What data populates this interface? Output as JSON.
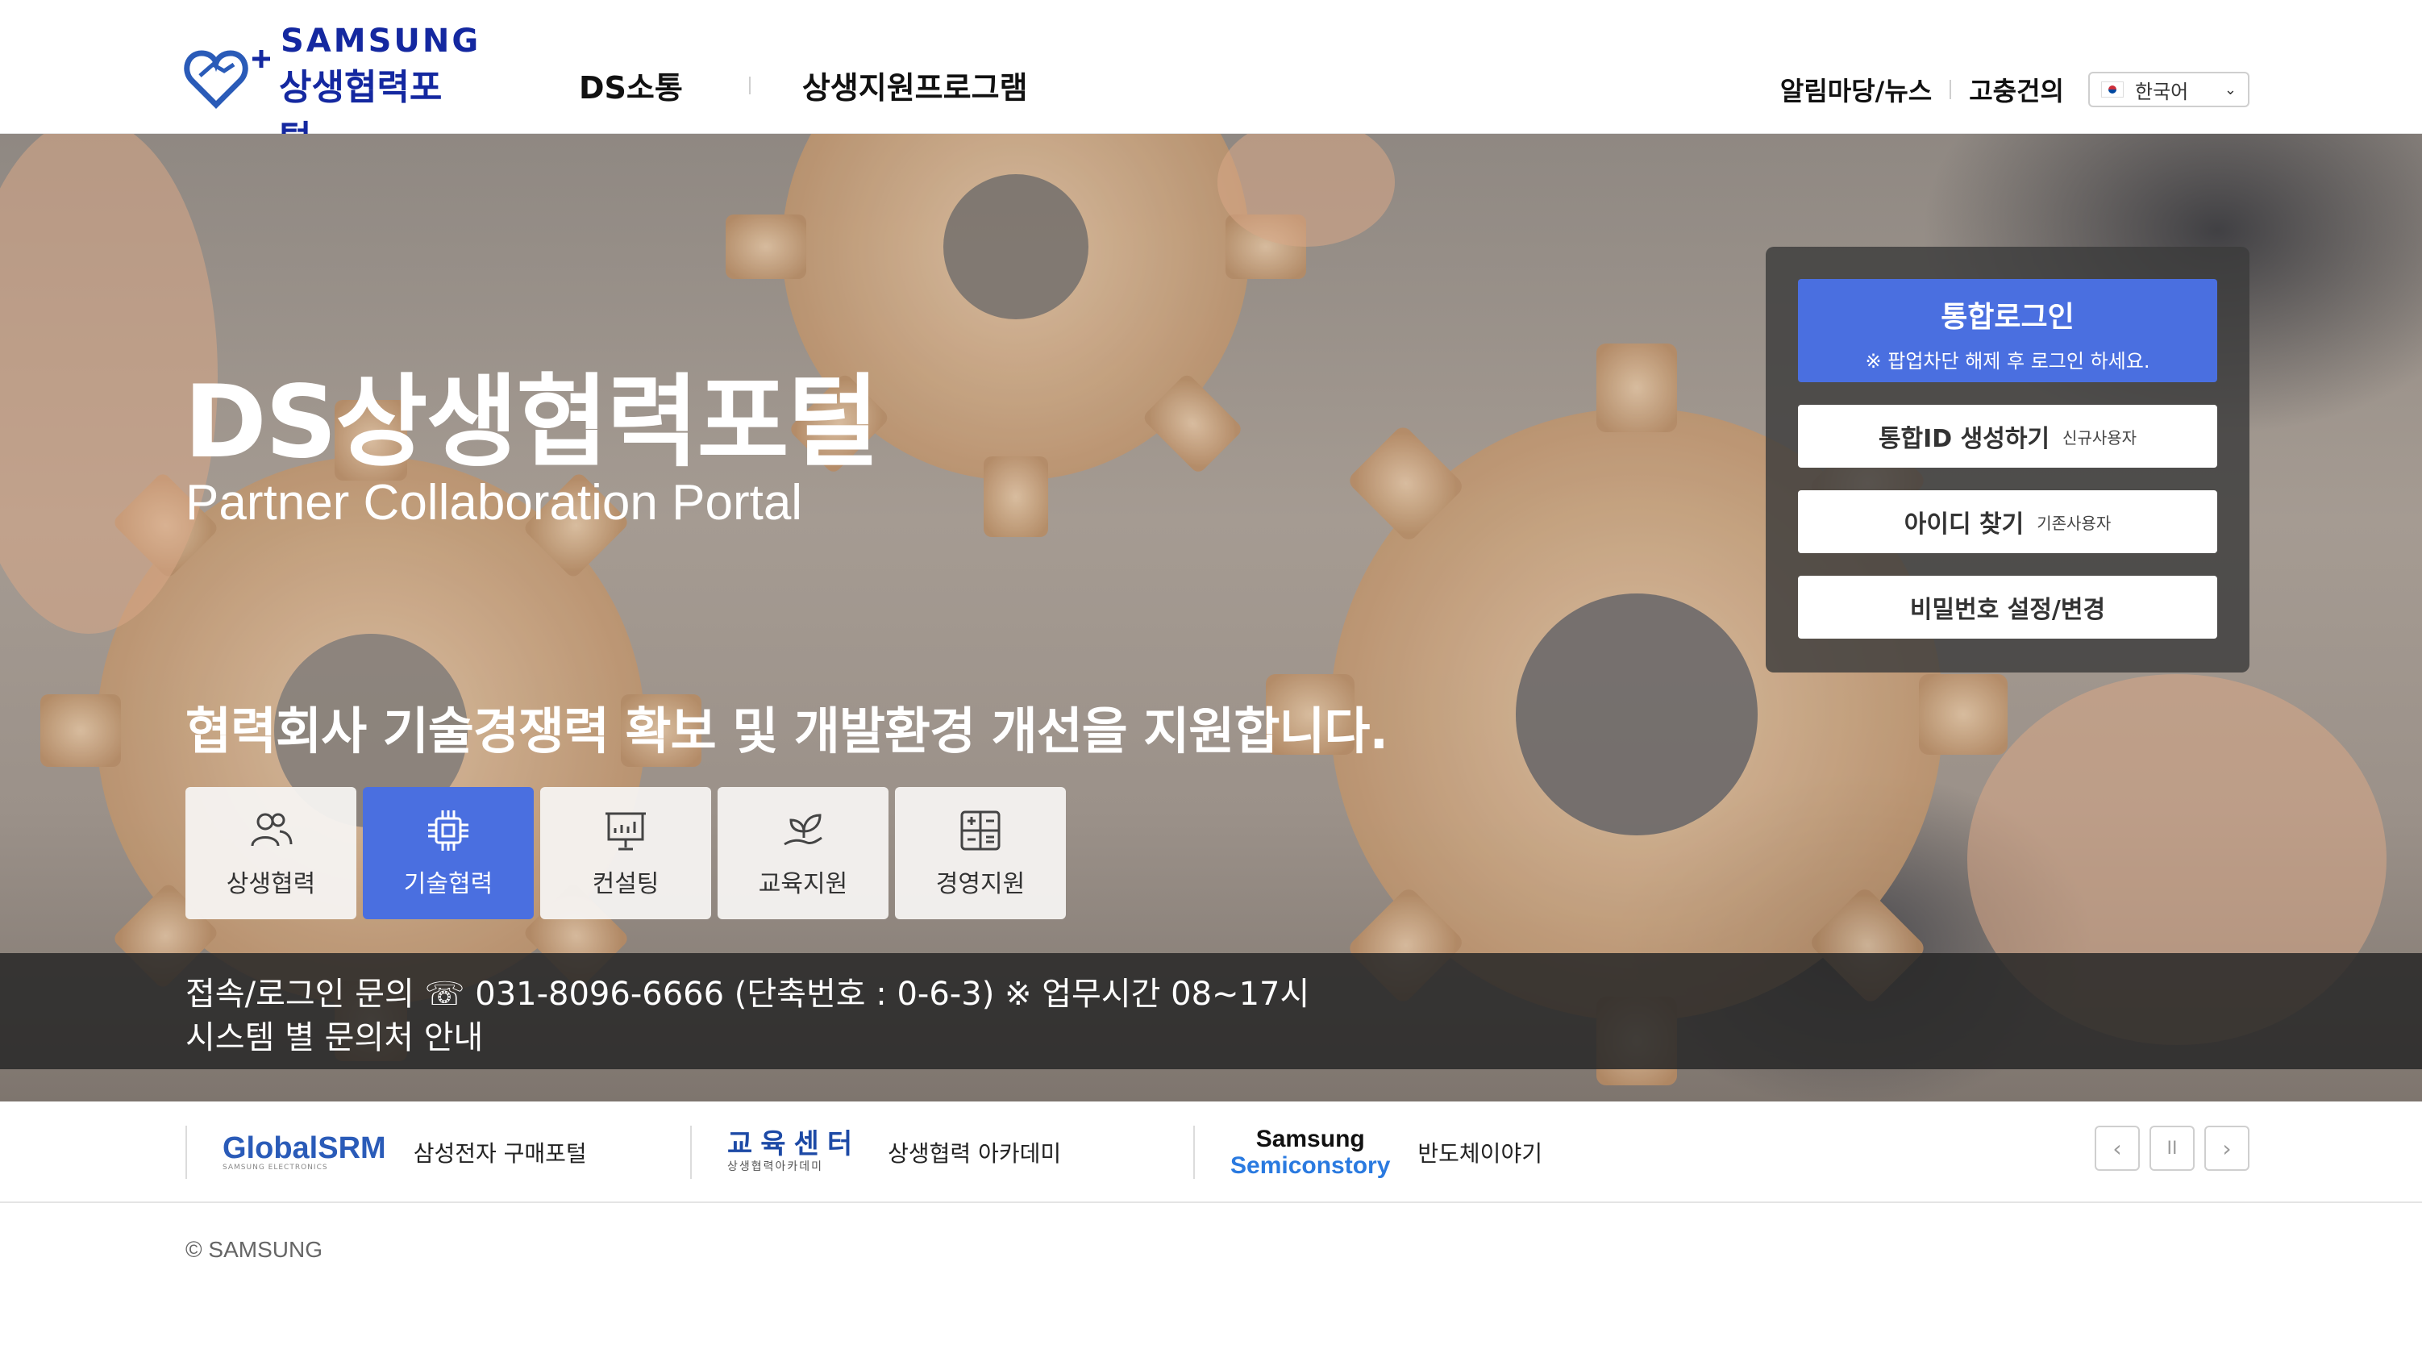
{
  "header": {
    "logo_brand": "SAMSUNG",
    "logo_portal": "상생협력포털",
    "nav": [
      "DS소통",
      "상생지원프로그램"
    ],
    "util_links": [
      "알림마당/뉴스",
      "고충건의"
    ],
    "language": "한국어"
  },
  "hero": {
    "title": "DS상생협력포털",
    "subtitle": "Partner Collaboration Portal",
    "description": "협력회사 기술경쟁력 확보 및 개발환경 개선을 지원합니다.",
    "tiles": [
      {
        "label": "상생협력",
        "icon": "people-icon",
        "active": false
      },
      {
        "label": "기술협력",
        "icon": "chip-icon",
        "active": true
      },
      {
        "label": "컨설팅",
        "icon": "presentation-icon",
        "active": false
      },
      {
        "label": "교육지원",
        "icon": "plant-hand-icon",
        "active": false
      },
      {
        "label": "경영지원",
        "icon": "grid-icon",
        "active": false
      }
    ],
    "notice_line1": "접속/로그인 문의 ☏ 031-8096-6666 (단축번호 : 0-6-3) ※ 업무시간 08~17시",
    "notice_line2": "시스템 별 문의처 안내"
  },
  "login": {
    "main_label": "통합로그인",
    "main_note": "※ 팝업차단 해제 후 로그인 하세요.",
    "create_id": "통합ID 생성하기",
    "create_id_note": "신규사용자",
    "find_id": "아이디 찾기",
    "find_id_note": "기존사용자",
    "password": "비밀번호 설정/변경"
  },
  "banners": [
    {
      "logo": "GlobalSRM",
      "logo_sub": "SAMSUNG ELECTRONICS",
      "text": "삼성전자 구매포털"
    },
    {
      "logo": "교육센터",
      "logo_sub": "상생협력아카데미",
      "text": "상생협력 아카데미"
    },
    {
      "logo_line1": "Samsung",
      "logo_line2": "Semiconstory",
      "text": "반도체이야기"
    }
  ],
  "banner_controls": {
    "prev": "‹",
    "pause": "II",
    "next": "›"
  },
  "footer": {
    "copyright": "© SAMSUNG"
  },
  "colors": {
    "brand_blue": "#1428a0",
    "accent_blue": "#4a6fe0"
  }
}
